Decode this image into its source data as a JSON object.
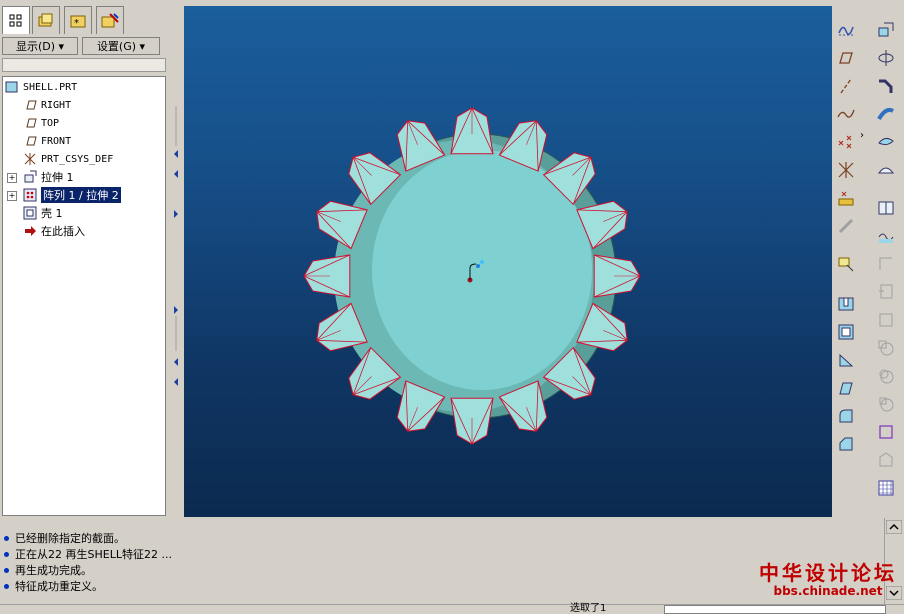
{
  "left_panel": {
    "tabs": [
      "model-tree-tab",
      "layer-tree-tab",
      "favorites-tab",
      "connections-tab"
    ],
    "show_menu": "显示(D) ▾",
    "settings_menu": "设置(G) ▾",
    "tree": [
      {
        "label": "SHELL.PRT",
        "icon": "part-icon",
        "depth": 0
      },
      {
        "label": "RIGHT",
        "icon": "datum-plane-icon",
        "depth": 1
      },
      {
        "label": "TOP",
        "icon": "datum-plane-icon",
        "depth": 1
      },
      {
        "label": "FRONT",
        "icon": "datum-plane-icon",
        "depth": 1
      },
      {
        "label": "PRT_CSYS_DEF",
        "icon": "csys-icon",
        "depth": 1
      },
      {
        "label": "拉伸 1",
        "icon": "extrude-icon",
        "depth": 1,
        "expandable": true
      },
      {
        "label": "阵列 1 / 拉伸 2",
        "icon": "pattern-icon",
        "depth": 1,
        "expandable": true,
        "selected": true
      },
      {
        "label": "壳 1",
        "icon": "shell-icon",
        "depth": 1
      },
      {
        "label": "在此插入",
        "icon": "insert-here-arrow-icon",
        "depth": 1
      }
    ]
  },
  "messages": [
    "已经删除指定的截面。",
    "正在从22 再生SHELL特征22 ...",
    "再生成功完成。",
    "特征成功重定义。"
  ],
  "status": {
    "filter_label": "选取了1",
    "filter_value": ""
  },
  "watermark": {
    "line1": "中华设计论坛",
    "line2": "bbs.chinade.net"
  },
  "colors": {
    "viewport_top": "#1a5e9c",
    "viewport_bottom": "#0b2a4f",
    "model_face": "#7fd0d0",
    "model_side": "#5a9e9a",
    "edge_highlight": "#d01030",
    "selection": "#0a246a"
  },
  "right_toolbar_1": [
    "sketch-curve-icon",
    "datum-plane-icon",
    "datum-axis-icon",
    "datum-curve-icon",
    "datum-point-icon",
    "datum-point-sketched-icon",
    "offset-point-icon",
    "csys-icon",
    "analysis-icon",
    "hole-icon",
    "round-icon",
    "chamfer-icon",
    "draft-icon",
    "rib-icon",
    "shell-icon"
  ],
  "right_toolbar_2": [
    "extrude-icon",
    "revolve-icon",
    "sweep-icon",
    "blend-icon",
    "variable-section-icon",
    "style-icon",
    "boundary-icon",
    "warp-icon",
    "merge-icon",
    "trim-icon",
    "pattern-icon",
    "mirror-icon",
    "offset-icon",
    "thicken-icon",
    "solidify-icon",
    "intersect-icon",
    "grid-icon"
  ]
}
